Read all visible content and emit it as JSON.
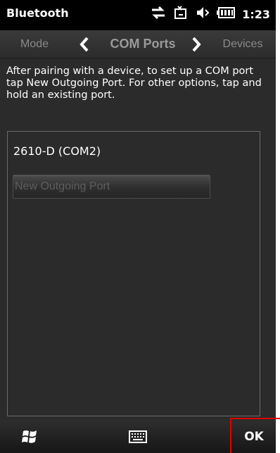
{
  "status_bar": {
    "title": "Bluetooth",
    "time": "1:23",
    "icons": [
      "connectivity-icon",
      "dialup-icon",
      "volume-icon",
      "battery-icon"
    ]
  },
  "tabs": [
    {
      "label": "Mode",
      "active": false
    },
    {
      "label": "COM Ports",
      "active": true
    },
    {
      "label": "Devices",
      "active": false
    }
  ],
  "main": {
    "description": "After pairing with a device, to set up a COM port tap New Outgoing Port. For other options, tap and hold an existing port.",
    "ports": [
      {
        "label": "2610-D (COM2)"
      }
    ],
    "new_port_label": "New Outgoing Port"
  },
  "bottom_bar": {
    "start_icon": "windows-start-icon",
    "keyboard_icon": "keyboard-icon",
    "ok_label": "OK"
  },
  "colors": {
    "highlight": "#e00000",
    "background": "#2b2b2b"
  }
}
